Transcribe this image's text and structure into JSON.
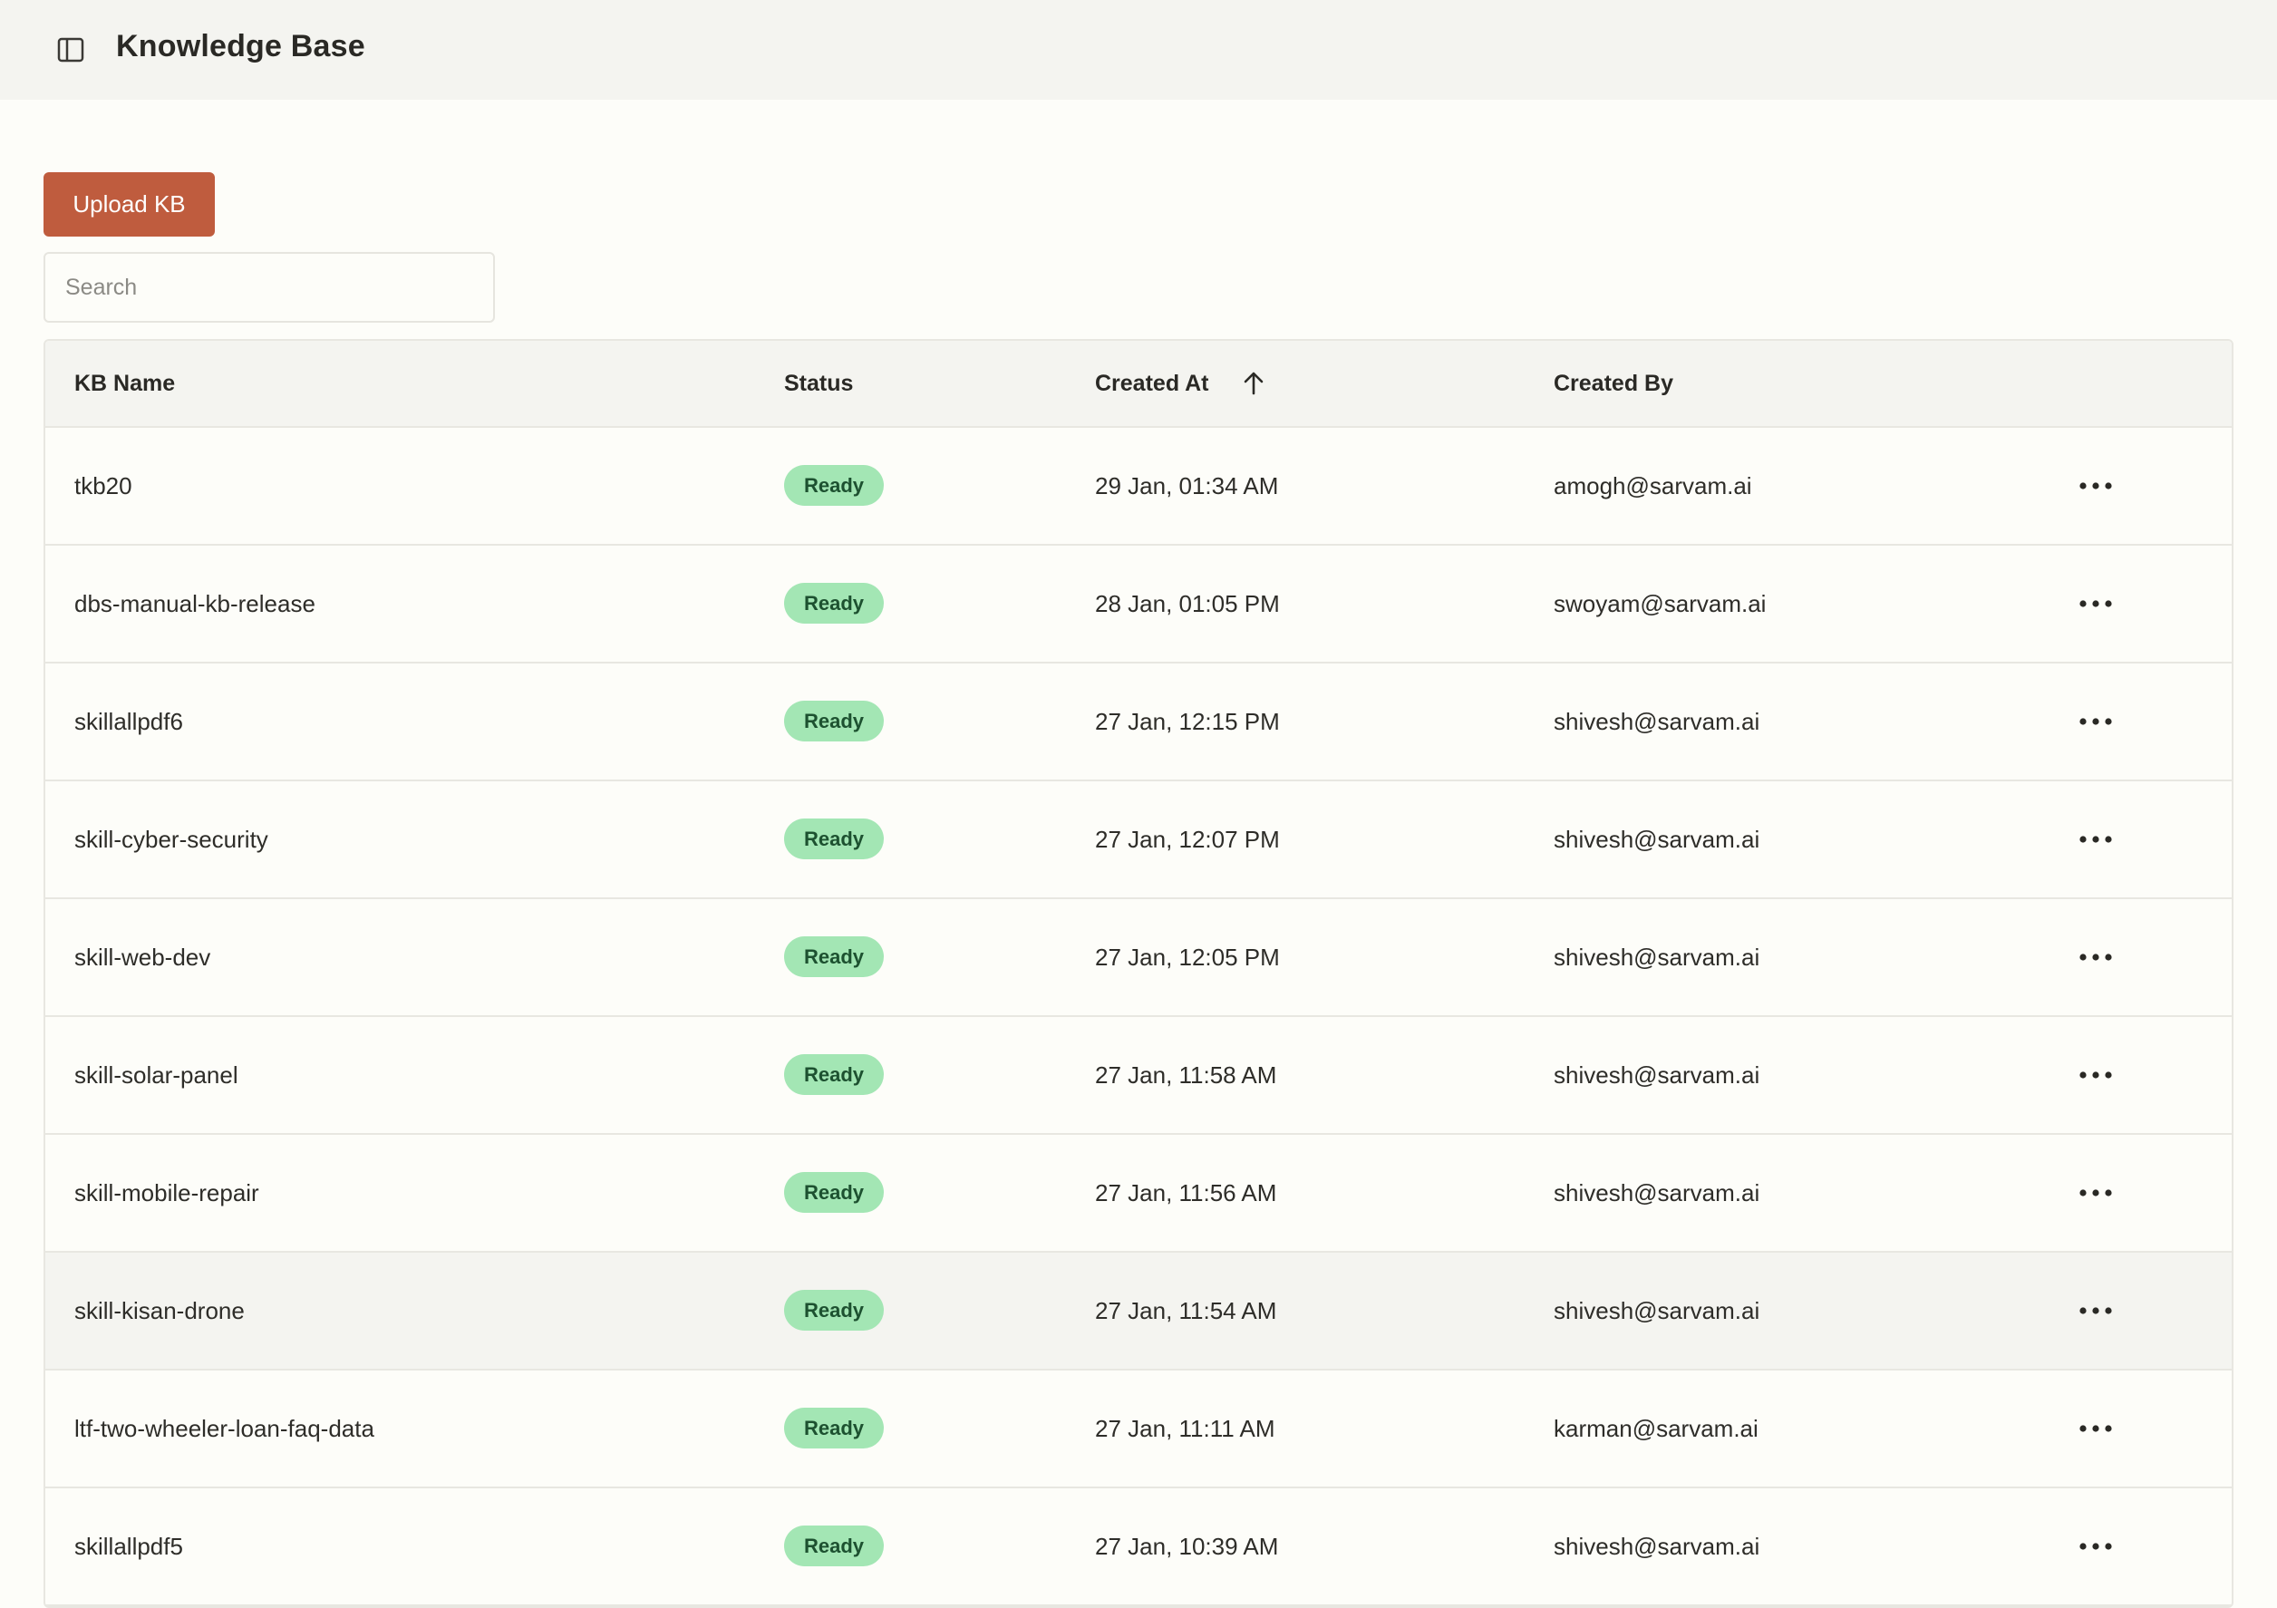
{
  "header": {
    "title": "Knowledge Base",
    "toggle_icon": "sidebar-toggle-icon"
  },
  "toolbar": {
    "upload_label": "Upload KB",
    "search_placeholder": "Search",
    "search_value": ""
  },
  "table": {
    "columns": {
      "name": "KB Name",
      "status": "Status",
      "created_at": "Created At",
      "created_by": "Created By"
    },
    "sort": {
      "column": "created_at",
      "icon": "arrow-up-icon"
    },
    "status_color": "#a3e6b4",
    "rows": [
      {
        "name": "tkb20",
        "status": "Ready",
        "created_at": "29 Jan, 01:34 AM",
        "created_by": "amogh@sarvam.ai"
      },
      {
        "name": "dbs-manual-kb-release",
        "status": "Ready",
        "created_at": "28 Jan, 01:05 PM",
        "created_by": "swoyam@sarvam.ai"
      },
      {
        "name": "skillallpdf6",
        "status": "Ready",
        "created_at": "27 Jan, 12:15 PM",
        "created_by": "shivesh@sarvam.ai"
      },
      {
        "name": "skill-cyber-security",
        "status": "Ready",
        "created_at": "27 Jan, 12:07 PM",
        "created_by": "shivesh@sarvam.ai"
      },
      {
        "name": "skill-web-dev",
        "status": "Ready",
        "created_at": "27 Jan, 12:05 PM",
        "created_by": "shivesh@sarvam.ai"
      },
      {
        "name": "skill-solar-panel",
        "status": "Ready",
        "created_at": "27 Jan, 11:58 AM",
        "created_by": "shivesh@sarvam.ai"
      },
      {
        "name": "skill-mobile-repair",
        "status": "Ready",
        "created_at": "27 Jan, 11:56 AM",
        "created_by": "shivesh@sarvam.ai"
      },
      {
        "name": "skill-kisan-drone",
        "status": "Ready",
        "created_at": "27 Jan, 11:54 AM",
        "created_by": "shivesh@sarvam.ai"
      },
      {
        "name": "ltf-two-wheeler-loan-faq-data",
        "status": "Ready",
        "created_at": "27 Jan, 11:11 AM",
        "created_by": "karman@sarvam.ai"
      },
      {
        "name": "skillallpdf5",
        "status": "Ready",
        "created_at": "27 Jan, 10:39 AM",
        "created_by": "shivesh@sarvam.ai"
      }
    ]
  }
}
